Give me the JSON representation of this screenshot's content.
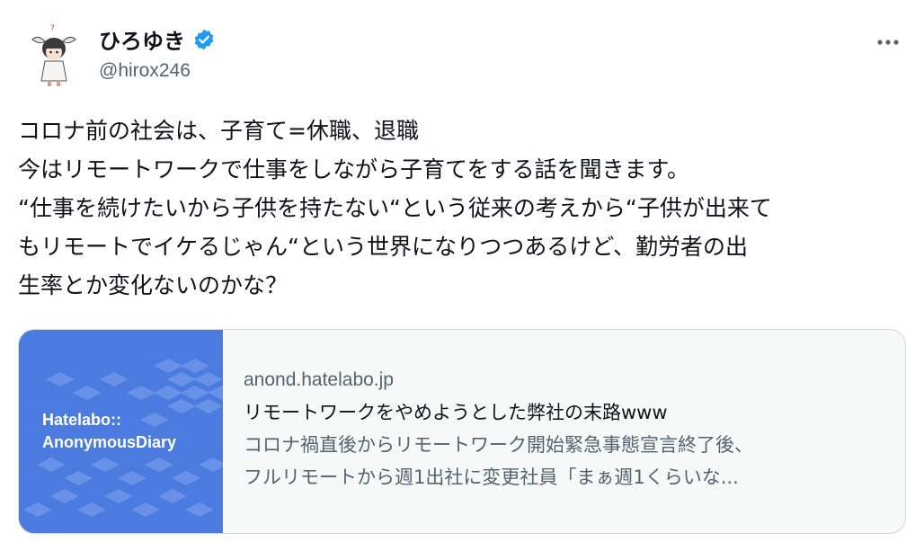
{
  "author": {
    "display_name": "ひろゆき",
    "handle": "@hirox246",
    "avatar_icon": "character-avatar-icon",
    "verified_icon": "verified-badge-icon",
    "verified_color": "#1d9bf0"
  },
  "menu": {
    "more_icon": "more-options-icon"
  },
  "tweet": {
    "lines": [
      "コロナ前の社会は、子育て=休職、退職",
      "今はリモートワークで仕事をしながら子育てをする話を聞きます。",
      "“仕事を続けたいから子供を持たない“という従来の考えから“子供が出来て",
      "もリモートでイケるじゃん“という世界になりつつあるけど、勤労者の出",
      "生率とか変化ないのかな？"
    ]
  },
  "card": {
    "thumbnail_title": [
      "Hatelabo::",
      "AnonymousDiary"
    ],
    "thumbnail_color": "#4c7be0",
    "domain": "anond.hatelabo.jp",
    "title": "リモートワークをやめようとした弊社の末路www",
    "description_lines": [
      "コロナ禍直後からリモートワーク開始緊急事態宣言終了後、",
      "フルリモートから週1出社に変更社員「まぁ週1くらいな..."
    ]
  }
}
